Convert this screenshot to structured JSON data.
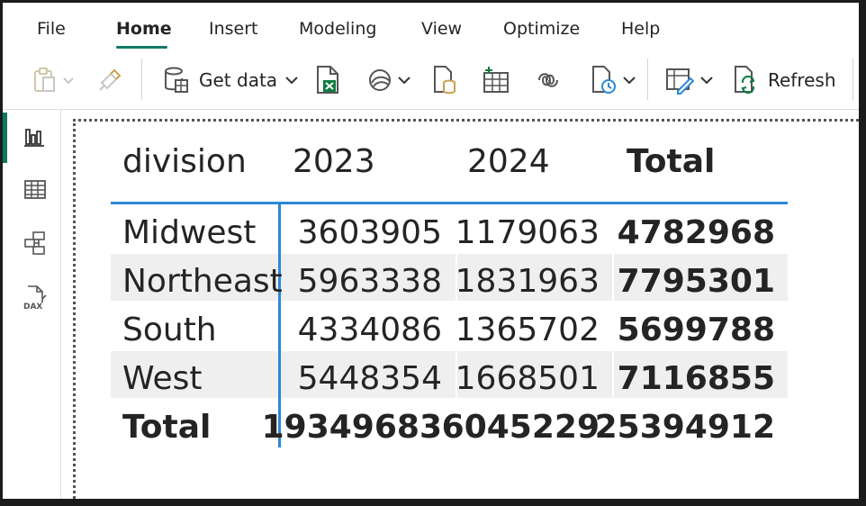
{
  "menu": {
    "tabs": [
      {
        "label": "File"
      },
      {
        "label": "Home"
      },
      {
        "label": "Insert"
      },
      {
        "label": "Modeling"
      },
      {
        "label": "View"
      },
      {
        "label": "Optimize"
      },
      {
        "label": "Help"
      }
    ],
    "active_tab": "Home",
    "accent_color": "#117865"
  },
  "ribbon": {
    "get_data_label": "Get data",
    "refresh_label": "Refresh",
    "icons": [
      "paste-icon",
      "format-painter-icon",
      "get-data-icon",
      "excel-workbook-icon",
      "onelake-hub-icon",
      "sql-server-icon",
      "enter-data-icon",
      "dataverse-icon",
      "recent-sources-icon",
      "transform-data-icon",
      "refresh-icon"
    ]
  },
  "rail": {
    "items": [
      "report-view-icon",
      "table-view-icon",
      "model-view-icon",
      "dax-query-view-icon"
    ],
    "active": "report-view-icon"
  },
  "matrix": {
    "headers": [
      "division",
      "2023",
      "2024",
      "Total"
    ],
    "rows": [
      {
        "division": "Midwest",
        "y2023": "3603905",
        "y2024": "1179063",
        "total": "4782968"
      },
      {
        "division": "Northeast",
        "y2023": "5963338",
        "y2024": "1831963",
        "total": "7795301"
      },
      {
        "division": "South",
        "y2023": "4334086",
        "y2024": "1365702",
        "total": "5699788"
      },
      {
        "division": "West",
        "y2023": "5448354",
        "y2024": "1668501",
        "total": "7116855"
      }
    ],
    "totals": {
      "label": "Total",
      "y2023": "19349683",
      "y2024": "6045229",
      "total": "25394912"
    },
    "accent_line_color": "#2b88d8",
    "band_color": "#efefef"
  }
}
